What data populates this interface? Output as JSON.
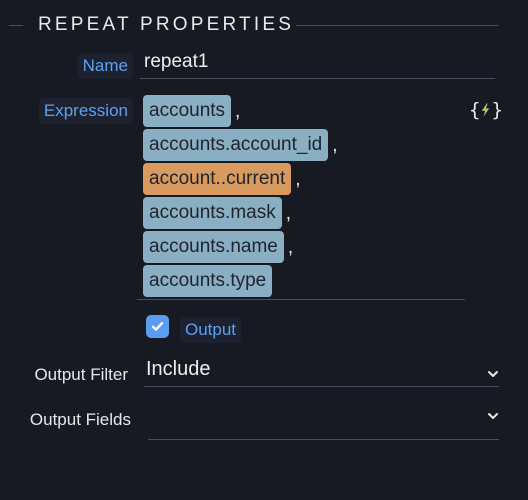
{
  "section": {
    "title": "REPEAT PROPERTIES"
  },
  "name": {
    "label": "Name",
    "value": "repeat1"
  },
  "expression": {
    "label": "Expression",
    "items": [
      {
        "text": "accounts",
        "comma": ",",
        "status": "valid"
      },
      {
        "text": "accounts.account_id",
        "comma": ",",
        "status": "valid"
      },
      {
        "text": "account..current",
        "comma": ",",
        "status": "invalid"
      },
      {
        "text": "accounts.mask",
        "comma": ",",
        "status": "valid"
      },
      {
        "text": "accounts.name",
        "comma": ",",
        "status": "valid"
      },
      {
        "text": "accounts.type",
        "comma": "",
        "status": "valid"
      }
    ],
    "icon_open": "{",
    "icon_close": "}",
    "icon": "expression-editor-icon"
  },
  "output": {
    "label": "Output",
    "checked": true
  },
  "output_filter": {
    "label": "Output Filter",
    "value": "Include"
  },
  "output_fields": {
    "label": "Output Fields",
    "value": ""
  },
  "colors": {
    "background": "#171923",
    "label_accent": "#5aa2f0",
    "pill_valid": "#8aafc2",
    "pill_invalid": "#d89a5e",
    "checkbox": "#5a9ef2",
    "bolt": "#a6c96a"
  }
}
